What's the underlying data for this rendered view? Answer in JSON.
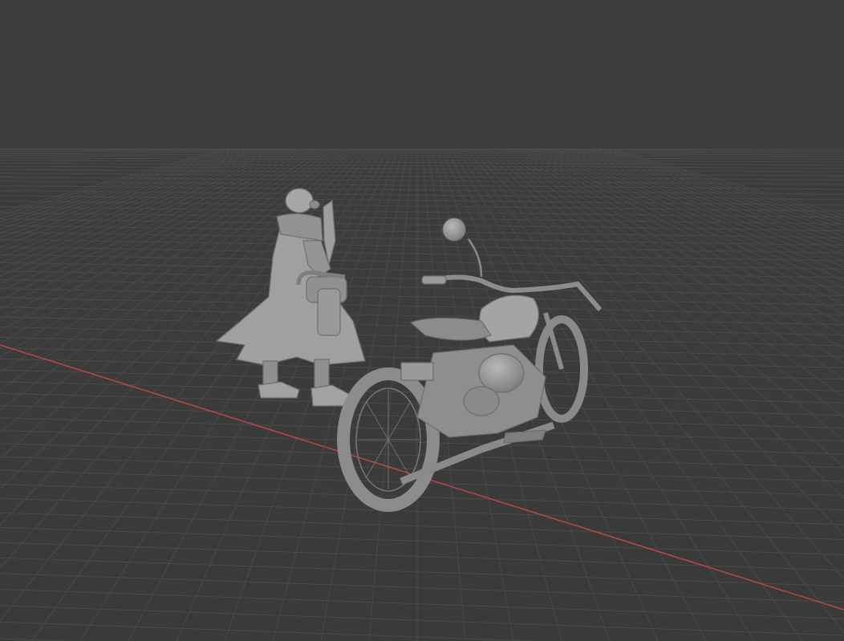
{
  "app": {
    "name": "3D viewport",
    "view": "perspective"
  },
  "viewport": {
    "background_color": "#3d3d3d",
    "grid_color": "#4a4a4a",
    "x_axis_color": "#b84848",
    "object_color": "#9a9a9a"
  },
  "scene": {
    "objects": [
      {
        "name": "character-figure",
        "icon": "character-mesh"
      },
      {
        "name": "motorcycle",
        "icon": "motorcycle-mesh"
      },
      {
        "name": "mirror-sphere",
        "icon": "sphere-mesh"
      }
    ]
  }
}
